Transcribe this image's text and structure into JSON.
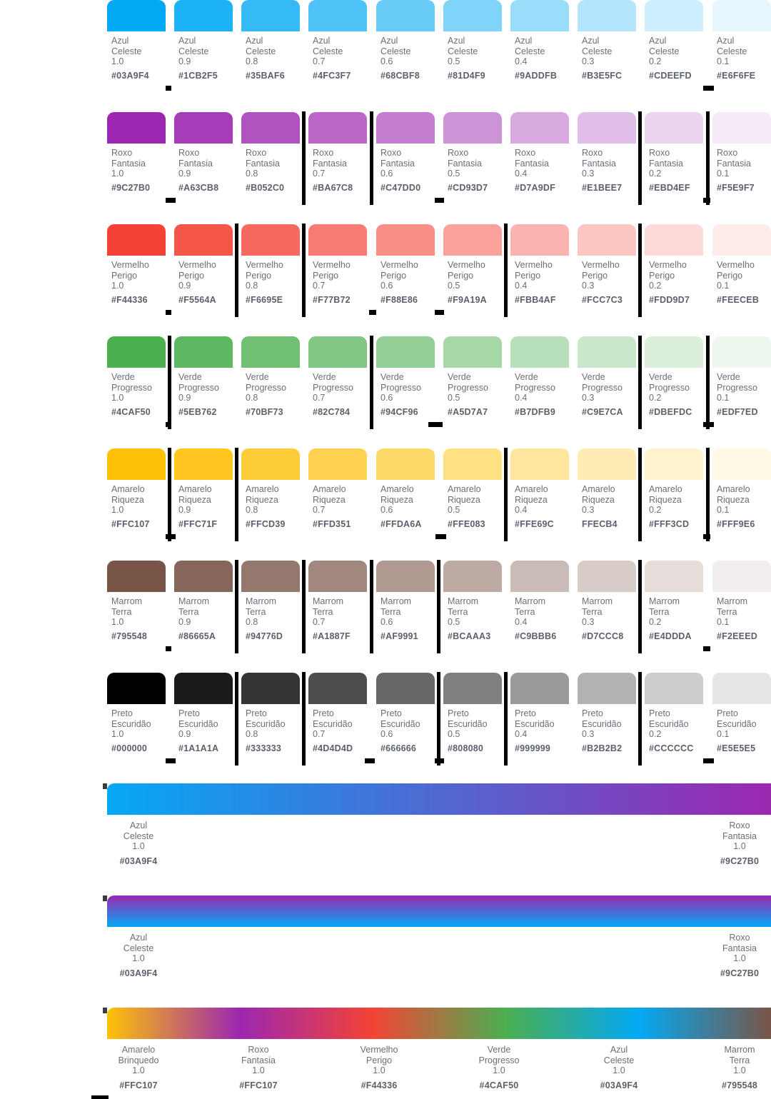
{
  "palettes": [
    {
      "name": "Azul Celeste",
      "label": "Azul\nCeleste",
      "shades": [
        {
          "opacity": "1.0",
          "hex": "#03A9F4"
        },
        {
          "opacity": "0.9",
          "hex": "#1CB2F5"
        },
        {
          "opacity": "0.8",
          "hex": "#35BAF6"
        },
        {
          "opacity": "0.7",
          "hex": "#4FC3F7"
        },
        {
          "opacity": "0.6",
          "hex": "#68CBF8"
        },
        {
          "opacity": "0.5",
          "hex": "#81D4F9"
        },
        {
          "opacity": "0.4",
          "hex": "#9ADDFB"
        },
        {
          "opacity": "0.3",
          "hex": "#B3E5FC"
        },
        {
          "opacity": "0.2",
          "hex": "#CDEEFD"
        },
        {
          "opacity": "0.1",
          "hex": "#E6F6FE"
        }
      ]
    },
    {
      "name": "Roxo Fantasia",
      "label": "Roxo\nFantasia",
      "shades": [
        {
          "opacity": "1.0",
          "hex": "#9C27B0"
        },
        {
          "opacity": "0.9",
          "hex": "#A63CB8"
        },
        {
          "opacity": "0.8",
          "hex": "#B052C0"
        },
        {
          "opacity": "0.7",
          "hex": "#BA67C8"
        },
        {
          "opacity": "0.6",
          "hex": "#C47DD0"
        },
        {
          "opacity": "0.5",
          "hex": "#CD93D7"
        },
        {
          "opacity": "0.4",
          "hex": "#D7A9DF"
        },
        {
          "opacity": "0.3",
          "hex": "#E1BEE7"
        },
        {
          "opacity": "0.2",
          "hex": "#EBD4EF"
        },
        {
          "opacity": "0.1",
          "hex": "#F5E9F7"
        }
      ]
    },
    {
      "name": "Vermelho Perigo",
      "label": "Vermelho\nPerigo",
      "shades": [
        {
          "opacity": "1.0",
          "hex": "#F44336"
        },
        {
          "opacity": "0.9",
          "hex": "#F5564A"
        },
        {
          "opacity": "0.8",
          "hex": "#F6695E"
        },
        {
          "opacity": "0.7",
          "hex": "#F77B72"
        },
        {
          "opacity": "0.6",
          "hex": "#F88E86"
        },
        {
          "opacity": "0.5",
          "hex": "#F9A19A"
        },
        {
          "opacity": "0.4",
          "hex": "#FBB4AF"
        },
        {
          "opacity": "0.3",
          "hex": "#FCC7C3"
        },
        {
          "opacity": "0.2",
          "hex": "#FDD9D7"
        },
        {
          "opacity": "0.1",
          "hex": "#FEECEB"
        }
      ]
    },
    {
      "name": "Verde Progresso",
      "label": "Verde\nProgresso",
      "shades": [
        {
          "opacity": "1.0",
          "hex": "#4CAF50"
        },
        {
          "opacity": "0.9",
          "hex": "#5EB762"
        },
        {
          "opacity": "0.8",
          "hex": "#70BF73"
        },
        {
          "opacity": "0.7",
          "hex": "#82C784"
        },
        {
          "opacity": "0.6",
          "hex": "#94CF96"
        },
        {
          "opacity": "0.5",
          "hex": "#A5D7A7"
        },
        {
          "opacity": "0.4",
          "hex": "#B7DFB9"
        },
        {
          "opacity": "0.3",
          "hex": "#C9E7CA"
        },
        {
          "opacity": "0.2",
          "hex": "#DBEFDC"
        },
        {
          "opacity": "0.1",
          "hex": "#EDF7ED"
        }
      ]
    },
    {
      "name": "Amarelo Riqueza",
      "label": "Amarelo\nRiqueza",
      "shades": [
        {
          "opacity": "1.0",
          "hex": "#FFC107"
        },
        {
          "opacity": "0.9",
          "hex": "#FFC71F"
        },
        {
          "opacity": "0.8",
          "hex": "#FFCD39"
        },
        {
          "opacity": "0.7",
          "hex": "#FFD351"
        },
        {
          "opacity": "0.6",
          "hex": "#FFDA6A"
        },
        {
          "opacity": "0.5",
          "hex": "#FFE083"
        },
        {
          "opacity": "0.4",
          "hex": "#FFE69C"
        },
        {
          "opacity": "0.3",
          "hex": "FFECB4"
        },
        {
          "opacity": "0.2",
          "hex": "#FFF3CD"
        },
        {
          "opacity": "0.1",
          "hex": "#FFF9E6"
        }
      ]
    },
    {
      "name": "Marrom Terra",
      "label": "Marrom\nTerra",
      "shades": [
        {
          "opacity": "1.0",
          "hex": "#795548"
        },
        {
          "opacity": "0.9",
          "hex": "#86665A"
        },
        {
          "opacity": "0.8",
          "hex": "#94776D"
        },
        {
          "opacity": "0.7",
          "hex": "#A1887F"
        },
        {
          "opacity": "0.6",
          "hex": "#AF9991"
        },
        {
          "opacity": "0.5",
          "hex": "#BCAAA3"
        },
        {
          "opacity": "0.4",
          "hex": "#C9BBB6"
        },
        {
          "opacity": "0.3",
          "hex": "#D7CCC8"
        },
        {
          "opacity": "0.2",
          "hex": "#E4DDDA"
        },
        {
          "opacity": "0.1",
          "hex": "#F2EEED"
        }
      ]
    },
    {
      "name": "Preto Escuridão",
      "label": "Preto\nEscuridão",
      "shades": [
        {
          "opacity": "1.0",
          "hex": "#000000"
        },
        {
          "opacity": "0.9",
          "hex": "#1A1A1A"
        },
        {
          "opacity": "0.8",
          "hex": "#333333"
        },
        {
          "opacity": "0.7",
          "hex": "#4D4D4D"
        },
        {
          "opacity": "0.6",
          "hex": "#666666"
        },
        {
          "opacity": "0.5",
          "hex": "#808080"
        },
        {
          "opacity": "0.4",
          "hex": "#999999"
        },
        {
          "opacity": "0.3",
          "hex": "#B2B2B2"
        },
        {
          "opacity": "0.2",
          "hex": "#CCCCCC"
        },
        {
          "opacity": "0.1",
          "hex": "#E5E5E5"
        }
      ]
    }
  ],
  "gradients": [
    {
      "direction": "horizontal",
      "colors": [
        "#03A9F4",
        "#9C27B0"
      ],
      "stops": [
        {
          "label": "Azul\nCeleste\n1.0",
          "hex": "#03A9F4"
        },
        {
          "label": "Roxo\nFantasia\n1.0",
          "hex": "#9C27B0"
        }
      ]
    },
    {
      "direction": "vertical",
      "colors": [
        "#9C27B0",
        "#03A9F4"
      ],
      "stops": [
        {
          "label": "Azul\nCeleste\n1.0",
          "hex": "#03A9F4"
        },
        {
          "label": "Roxo\nFantasia\n1.0",
          "hex": "#9C27B0"
        }
      ]
    },
    {
      "direction": "horizontal",
      "colors": [
        "#FFC107",
        "#9C27B0",
        "#F44336",
        "#4CAF50",
        "#03A9F4",
        "#795548"
      ],
      "stops": [
        {
          "label": "Amarelo\nBrinquedo\n1.0",
          "hex": "#FFC107"
        },
        {
          "label": "Roxo\nFantasia\n1.0",
          "hex": "#FFC107"
        },
        {
          "label": "Vermelho\nPerigo\n1.0",
          "hex": "#F44336"
        },
        {
          "label": "Verde\nProgresso\n1.0",
          "hex": "#4CAF50"
        },
        {
          "label": "Azul\nCeleste\n1.0",
          "hex": "#03A9F4"
        },
        {
          "label": "Marrom\nTerra\n1.0",
          "hex": "#795548"
        }
      ]
    }
  ]
}
